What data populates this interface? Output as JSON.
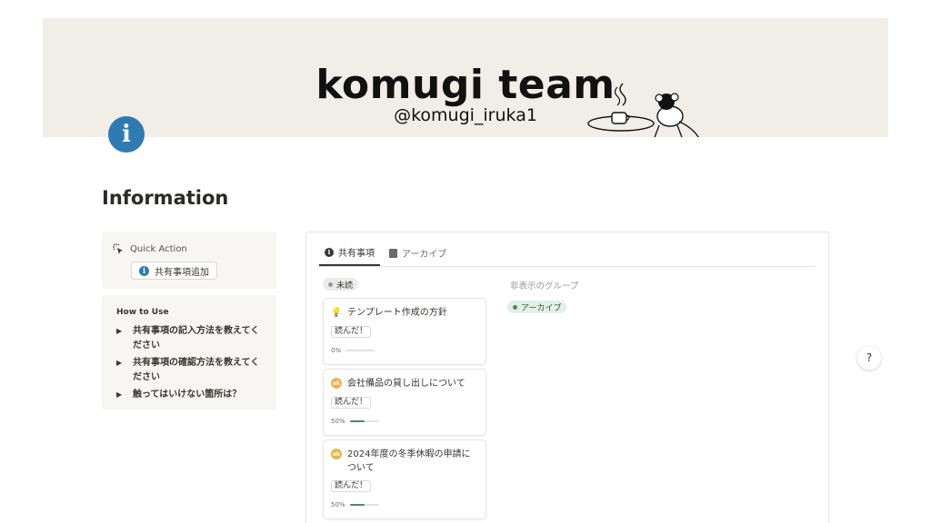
{
  "cover": {
    "title": "komugi team",
    "handle": "@komugi_iruka1"
  },
  "page": {
    "icon": "info-icon",
    "icon_glyph": "i",
    "title": "Information"
  },
  "quick_action": {
    "label": "Quick Action",
    "button_label": "共有事項追加",
    "button_icon_glyph": "i"
  },
  "how_to": {
    "title": "How to Use",
    "items": [
      {
        "label": "共有事項の記入方法を教えてください"
      },
      {
        "label": "共有事項の確認方法を教えてください"
      },
      {
        "label": "触ってはいけない箇所は？"
      }
    ]
  },
  "database": {
    "tabs": [
      {
        "label": "共有事項",
        "icon": "info-icon",
        "active": true
      },
      {
        "label": "アーカイブ",
        "icon": "document-icon",
        "active": false
      }
    ],
    "group_unread": "未読",
    "hidden_groups_label": "非表示のグループ",
    "group_archive": "アーカイブ",
    "cards": [
      {
        "title": "テンプレート作成の方針",
        "icon": "lightbulb-icon",
        "tag": "読んだ！",
        "progress_label": "0%",
        "progress": 0
      },
      {
        "title": "会社備品の貸し出しについて",
        "icon": "ok-badge-icon",
        "tag": "読んだ！",
        "progress_label": "50%",
        "progress": 0.5
      },
      {
        "title": "2024年度の冬季休暇の申請について",
        "icon": "ok-badge-icon",
        "tag": "読んだ！",
        "progress_label": "50%",
        "progress": 0.5
      }
    ]
  },
  "colors": {
    "page_icon": "#2f7ab3",
    "cover_bg": "#f1eee8",
    "progress_fill": "#4e8a61",
    "archive_pill": "#e3efe7"
  },
  "side_button": {
    "icon": "help-icon",
    "glyph": "?"
  }
}
